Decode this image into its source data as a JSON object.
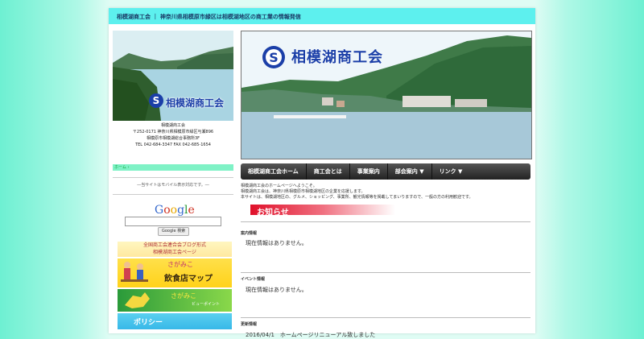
{
  "header": {
    "text": "相模湖商工会 ｜ 神奈川県相模原市緑区は相模湖地区の商工業の情報発信"
  },
  "sidebar": {
    "logo_text": "相模湖商工会",
    "address_lines": [
      "相模湖商工会",
      "〒252-0171 神奈川県相模原市緑区与瀬896",
      "相模原市相模湖総合事務所3F",
      "TEL 042-684-3347 FAX 042-685-1654"
    ],
    "home_link": "ホーム ›",
    "mobile_note": "―当サイトはモバイル表示対応です。―",
    "google": {
      "logo": "Google",
      "search_button": "Google 検索"
    },
    "banners": {
      "blog": {
        "line1": "全国商工会連合会ブログ形式",
        "line2": "相模湖商工会ページ"
      },
      "restaurant": {
        "line1": "さがみこ",
        "line2": "飲食店マップ"
      },
      "spot": {
        "line1": "さがみこ",
        "line2": "ビューポイント"
      },
      "policy": {
        "label": "ポリシー"
      }
    }
  },
  "hero": {
    "title": "相模湖商工会"
  },
  "nav": {
    "items": [
      "相模湖商工会ホーム",
      "商工会とは",
      "事業案内",
      "部会案内 ▼",
      "リンク ▼"
    ]
  },
  "intro": {
    "lines": [
      "相模湖商工会のホームページへようこそ。",
      "相模湖商工会は、神奈川県相模原市相模湖地区の企業を応援します。",
      "本サイトは、相模湖地区の、グルメ、ショッピング、事業所、観光情報等を掲載してまいりますので、一般の方の利用歓迎です。"
    ]
  },
  "notice": {
    "title": "お知らせ"
  },
  "sections": [
    {
      "title": "案内情報",
      "text": "現在情報はありません。"
    },
    {
      "title": "イベント情報",
      "text": "現在情報はありません。"
    },
    {
      "title": "更新情報",
      "text": "2016/04/1　ホームページリニューアル致しました"
    }
  ],
  "colors": {
    "background": "#6ef0d2",
    "header_bar": "#5df0ee",
    "notice_red": "#e0102a",
    "logo_blue": "#1b3fa8"
  }
}
